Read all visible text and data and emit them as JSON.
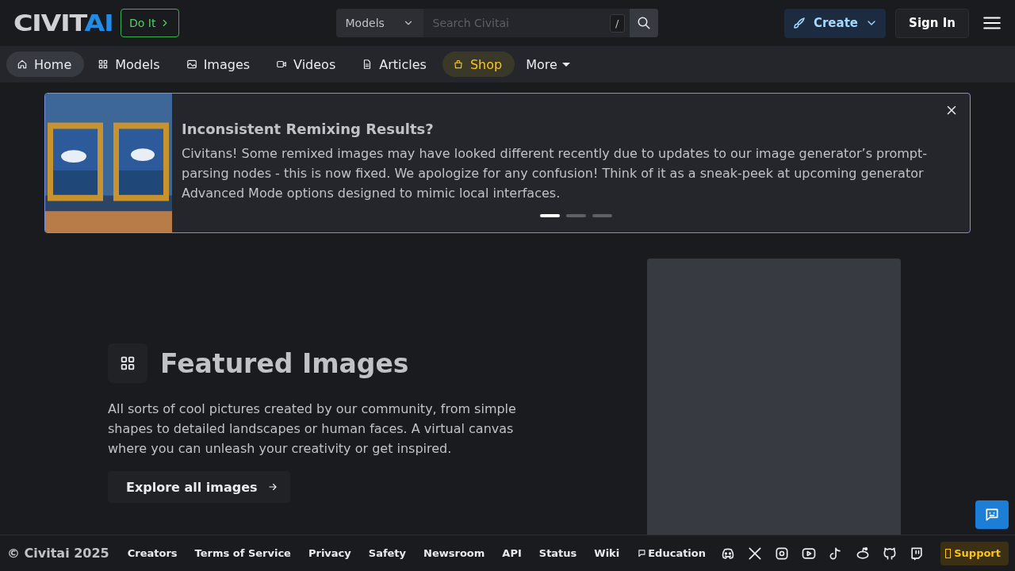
{
  "header": {
    "logo_main": "CIVIT",
    "logo_accent": "AI",
    "cta": "Do It",
    "search": {
      "scope": "Models",
      "placeholder": "Search Civitai",
      "shortcut": "/"
    },
    "create": "Create",
    "sign_in": "Sign In"
  },
  "nav": {
    "items": [
      {
        "label": "Home",
        "kind": "link",
        "selected": true
      },
      {
        "label": "Models",
        "kind": "link",
        "selected": false
      },
      {
        "label": "Images",
        "kind": "link",
        "selected": false
      },
      {
        "label": "Videos",
        "kind": "link",
        "selected": false
      },
      {
        "label": "Articles",
        "kind": "link",
        "selected": false
      },
      {
        "label": "Shop",
        "kind": "shop",
        "selected": false
      }
    ],
    "more": "More"
  },
  "banner": {
    "title": "Inconsistent Remixing Results?",
    "body": "Civitans! Some remixed images may have looked different recently due to updates to our image generator’s prompt-parsing nodes - this is now fixed. We apologize for any confusion! Think of it as a sneak-peek at upcoming generator Advanced Mode options designed to mimic local interfaces.",
    "slides": [
      {
        "selected": true
      },
      {
        "selected": false
      },
      {
        "selected": false
      }
    ]
  },
  "featured": {
    "title": "Featured Images",
    "description": "All sorts of cool pictures created by our community, from simple shapes to detailed landscapes or human faces. A virtual canvas where you can unleash your creativity or get inspired.",
    "button": "Explore all images"
  },
  "footer": {
    "copyright": "© Civitai 2025",
    "links": [
      "Creators",
      "Terms of Service",
      "Privacy",
      "Safety",
      "Newsroom",
      "API",
      "Status",
      "Wiki",
      "Education"
    ],
    "support": "Support"
  }
}
